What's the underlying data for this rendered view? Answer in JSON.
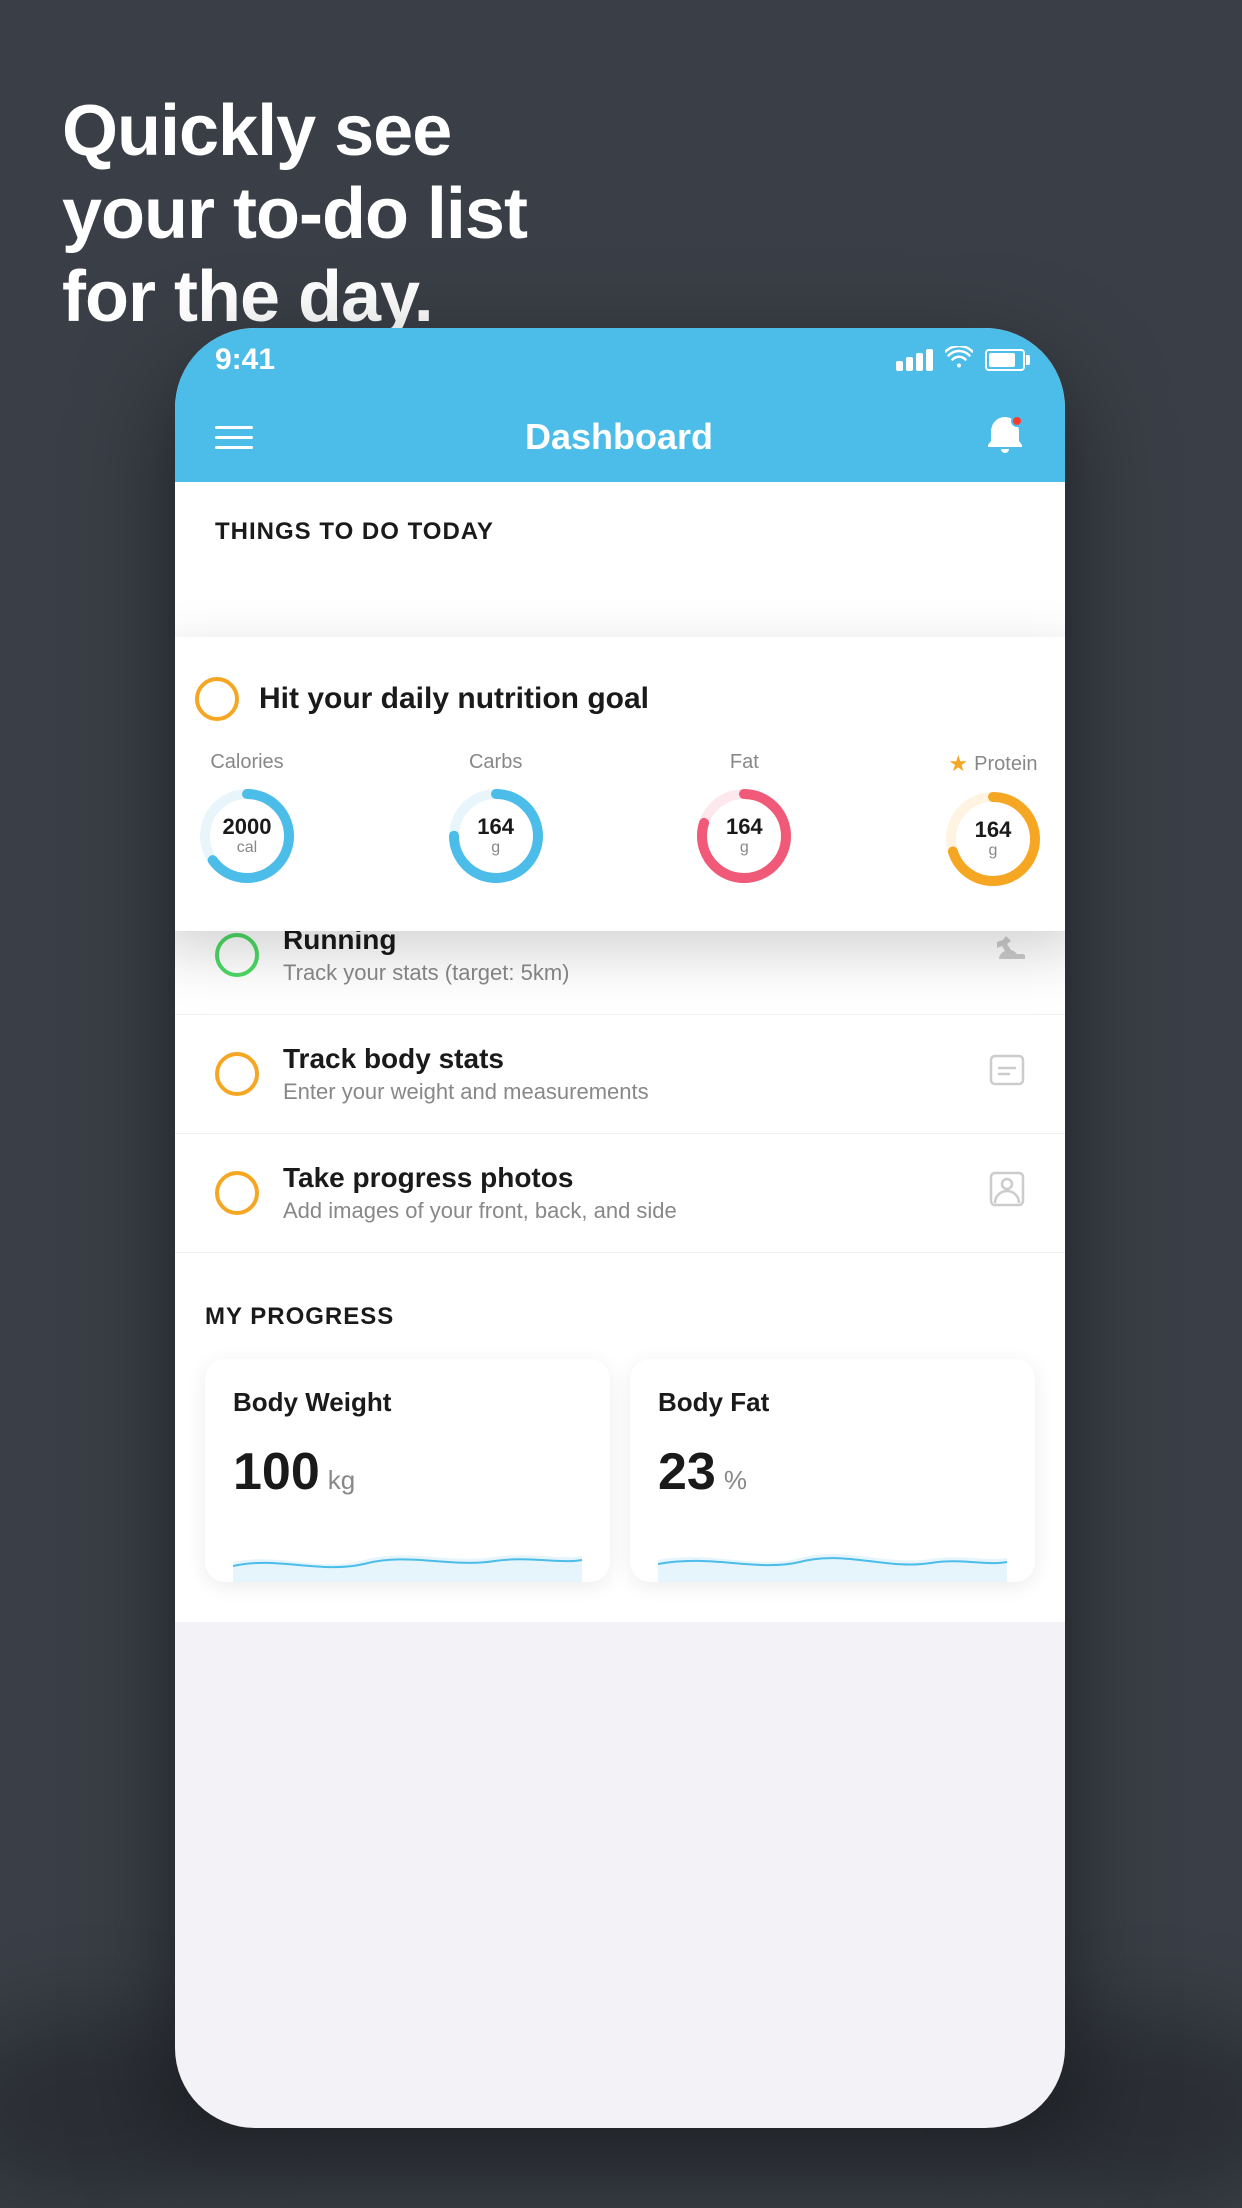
{
  "headline": {
    "line1": "Quickly see",
    "line2": "your to-do list",
    "line3": "for the day."
  },
  "status_bar": {
    "time": "9:41"
  },
  "nav": {
    "title": "Dashboard"
  },
  "things_section": {
    "header": "THINGS TO DO TODAY"
  },
  "floating_card": {
    "title": "Hit your daily nutrition goal",
    "nutrition": [
      {
        "label": "Calories",
        "value": "2000",
        "unit": "cal",
        "color": "#4bbde8",
        "pct": 65
      },
      {
        "label": "Carbs",
        "value": "164",
        "unit": "g",
        "color": "#4bbde8",
        "pct": 75
      },
      {
        "label": "Fat",
        "value": "164",
        "unit": "g",
        "color": "#f05a78",
        "pct": 80
      },
      {
        "label": "Protein",
        "value": "164",
        "unit": "g",
        "color": "#f5a623",
        "pct": 70,
        "starred": true
      }
    ]
  },
  "tasks": [
    {
      "name": "Running",
      "desc": "Track your stats (target: 5km)",
      "circle_color": "green",
      "icon": "shoe"
    },
    {
      "name": "Track body stats",
      "desc": "Enter your weight and measurements",
      "circle_color": "yellow",
      "icon": "scale"
    },
    {
      "name": "Take progress photos",
      "desc": "Add images of your front, back, and side",
      "circle_color": "yellow",
      "icon": "person"
    }
  ],
  "progress": {
    "header": "MY PROGRESS",
    "cards": [
      {
        "title": "Body Weight",
        "value": "100",
        "unit": "kg"
      },
      {
        "title": "Body Fat",
        "value": "23",
        "unit": "%"
      }
    ]
  }
}
